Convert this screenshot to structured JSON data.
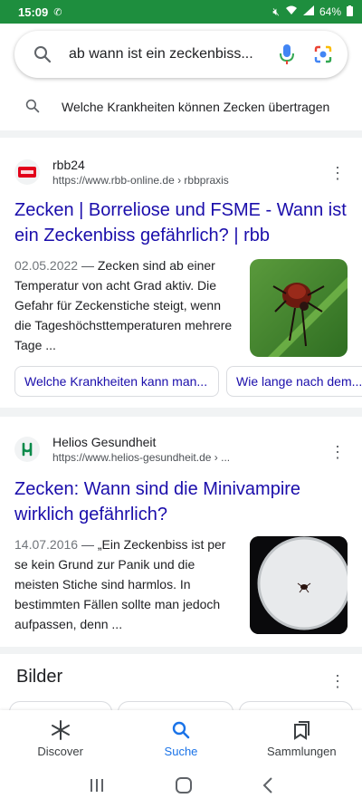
{
  "status_bar": {
    "time": "15:09",
    "battery": "64%"
  },
  "search": {
    "query": "ab wann ist ein zeckenbiss..."
  },
  "suggestion": {
    "text": "Welche Krankheiten können Zecken übertragen"
  },
  "results": [
    {
      "source": "rbb24",
      "url": "https://www.rbb-online.de",
      "path": "› rbbpraxis",
      "favicon_label": "rbb24",
      "title": "Zecken | Borreliose und FSME - Wann ist ein Zeckenbiss gefährlich? | rbb",
      "date": "02.05.2022",
      "snippet": "Zecken sind ab einer Temperatur von acht Grad aktiv. Die Gefahr für Zeckenstiche steigt, wenn die Tageshöchsttemperaturen mehrere Tage ...",
      "chips": [
        "Welche Krankheiten kann man...",
        "Wie lange nach dem..."
      ]
    },
    {
      "source": "Helios Gesundheit",
      "url": "https://www.helios-gesundheit.de",
      "path": "› ...",
      "title": "Zecken: Wann sind die Minivampire wirklich gefährlich?",
      "date": "14.07.2016",
      "snippet": "„Ein Zeckenbiss ist per se kein Grund zur Panik und die meisten Stiche sind harmlos. In bestimmten Fällen sollte man jedoch aufpassen, denn ..."
    }
  ],
  "images_section": {
    "title": "Bilder"
  },
  "bottom_nav": [
    {
      "label": "Discover",
      "icon": "asterisk-icon"
    },
    {
      "label": "Suche",
      "icon": "search-icon"
    },
    {
      "label": "Sammlungen",
      "icon": "bookmark-icon"
    }
  ],
  "colors": {
    "status_bar": "#1e8e3e",
    "link": "#1a0dab",
    "active": "#1a73e8"
  }
}
